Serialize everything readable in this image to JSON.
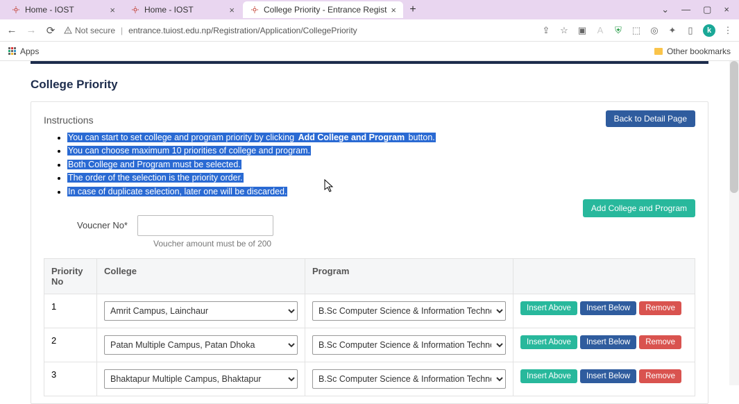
{
  "browser": {
    "tabs": [
      {
        "title": "Home - IOST",
        "active": false
      },
      {
        "title": "Home - IOST",
        "active": false
      },
      {
        "title": "College Priority - Entrance Regist",
        "active": true
      }
    ],
    "url": "entrance.tuiost.edu.np/Registration/Application/CollegePriority",
    "not_secure_label": "Not secure",
    "apps_label": "Apps",
    "other_bookmarks_label": "Other bookmarks",
    "avatar_letter": "k"
  },
  "page": {
    "title": "College Priority",
    "back_button": "Back to Detail Page",
    "instructions_heading": "Instructions",
    "instructions": {
      "i1_pre": "You can start to set college and program priority by clicking ",
      "i1_bold": "Add College and Program",
      "i1_post": " button.",
      "i2": "You can choose maximum 10 priorities of college and program.",
      "i3": "Both College and Program must be selected.",
      "i4": "The order of the selection is the priority order.",
      "i5": "In case of duplicate selection, later one will be discarded."
    },
    "add_button": "Add College and Program",
    "voucher": {
      "label": "Voucner No*",
      "help": "Voucher amount must be of 200"
    },
    "table": {
      "headers": {
        "pno": "Priority No",
        "college": "College",
        "program": "Program"
      },
      "rows": [
        {
          "no": "1",
          "college": "Amrit Campus, Lainchaur",
          "program": "B.Sc Computer Science & Information Technology i"
        },
        {
          "no": "2",
          "college": "Patan Multiple Campus, Patan Dhoka",
          "program": "B.Sc Computer Science & Information Technology i"
        },
        {
          "no": "3",
          "college": "Bhaktapur Multiple Campus, Bhaktapur",
          "program": "B.Sc Computer Science & Information Technology i"
        }
      ],
      "action_labels": {
        "insert_above": "Insert Above",
        "insert_below": "Insert Below",
        "remove": "Remove"
      }
    }
  }
}
